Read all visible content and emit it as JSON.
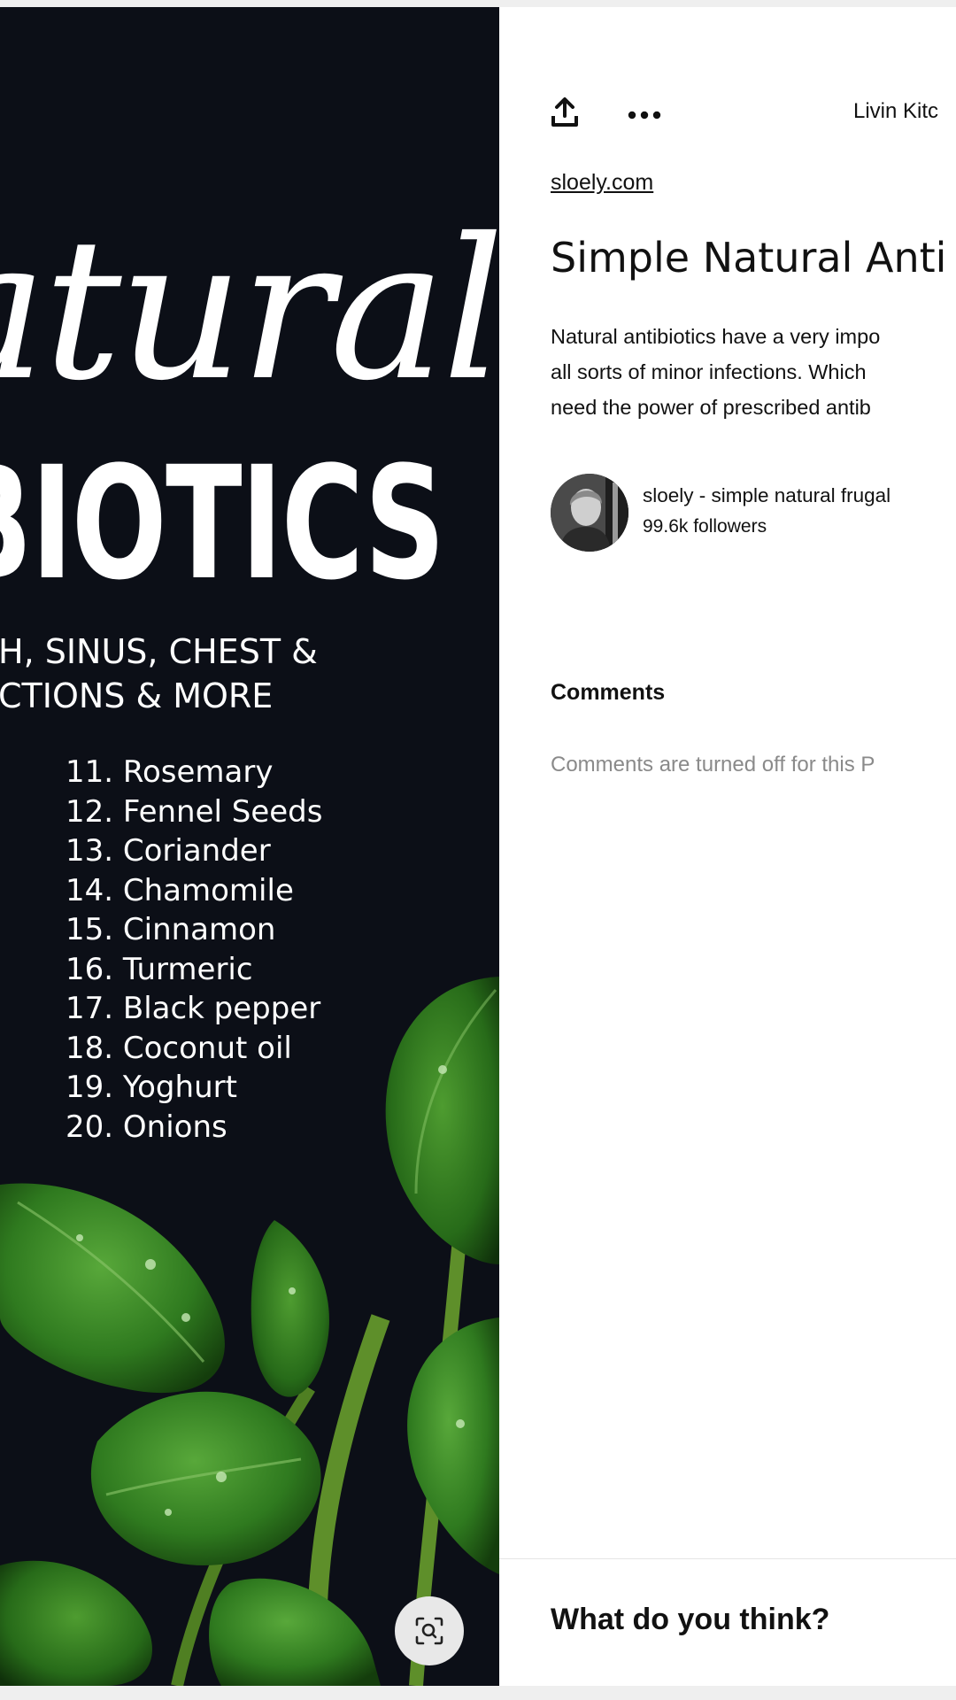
{
  "pin_image": {
    "script_title": "atural",
    "bold_title": "BIOTICS",
    "subtitle_lines": [
      "H, SINUS, CHEST &",
      "CTIONS & MORE"
    ],
    "remedies": [
      "11. Rosemary",
      "12. Fennel Seeds",
      "13. Coriander",
      "14. Chamomile",
      "15. Cinnamon",
      "16. Turmeric",
      "17. Black pepper",
      "18. Coconut oil",
      "19. Yoghurt",
      "20. Onions"
    ],
    "lens_icon": "visual-search-icon"
  },
  "toolbar": {
    "share_icon": "share-upload-icon",
    "more_icon": "more-options-icon",
    "board_name": "Livin Kitc"
  },
  "pin": {
    "source_link": "sloely.com",
    "title": "Simple Natural Anti",
    "description_lines": [
      "Natural antibiotics have a very impo",
      "all sorts of minor infections. Which",
      "need the power of prescribed antib"
    ]
  },
  "creator": {
    "name": "sloely - simple natural frugal",
    "followers": "99.6k followers"
  },
  "comments": {
    "heading": "Comments",
    "status": "Comments are turned off for this P"
  },
  "comment_box": {
    "prompt": "What do you think?"
  },
  "colors": {
    "image_background": "#0c0f17",
    "leaf_green": "#2f7a1f",
    "text_primary": "#111111",
    "text_muted": "#8a8a8a"
  }
}
